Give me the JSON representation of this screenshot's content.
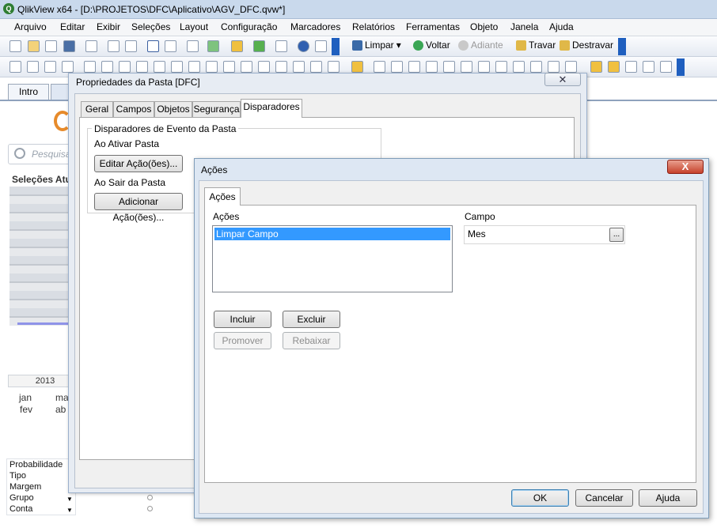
{
  "app": {
    "title": "QlikView x64 - [D:\\PROJETOS\\DFC\\Aplicativo\\AGV_DFC.qvw*]",
    "icon_letter": "Q"
  },
  "menu": [
    "Arquivo",
    "Editar",
    "Exibir",
    "Seleções",
    "Layout",
    "Configuração",
    "Marcadores",
    "Relatórios",
    "Ferramentas",
    "Objeto",
    "Janela",
    "Ajuda"
  ],
  "toolbar": {
    "limpar": "Limpar",
    "voltar": "Voltar",
    "adiante": "Adiante",
    "travar": "Travar",
    "destravar": "Destravar"
  },
  "sheet": {
    "tabs": [
      "Intro"
    ],
    "search_placeholder": "Pesquisa",
    "selections_title": "Seleções Atu",
    "year": "2013",
    "months_row1": [
      "jan",
      "ma"
    ],
    "months_row2": [
      "fev",
      "ab"
    ],
    "fields": [
      "Probabilidade",
      "Tipo",
      "Margem",
      "Grupo",
      "Conta"
    ]
  },
  "props_dialog": {
    "title": "Propriedades da Pasta [DFC]",
    "tabs": [
      "Geral",
      "Campos",
      "Objetos",
      "Segurança",
      "Disparadores"
    ],
    "group_label": "Disparadores de Evento da Pasta",
    "on_activate": "Ao Ativar Pasta",
    "edit_action": "Editar Ação(ões)...",
    "on_leave": "Ao Sair da Pasta",
    "add_action": "Adicionar Ação(ões)..."
  },
  "acoes_dialog": {
    "title": "Ações",
    "tab": "Ações",
    "list_label": "Ações",
    "list_items": [
      "Limpar Campo"
    ],
    "campo_label": "Campo",
    "campo_value": "Mes",
    "browse": "...",
    "incluir": "Incluir",
    "excluir": "Excluir",
    "promover": "Promover",
    "rebaixar": "Rebaixar",
    "ok": "OK",
    "cancelar": "Cancelar",
    "ajuda": "Ajuda",
    "close": "X"
  },
  "colors": {
    "selection": "#3399ff",
    "close_red": "#c6412b",
    "title_bg": "#c9d9ec"
  }
}
